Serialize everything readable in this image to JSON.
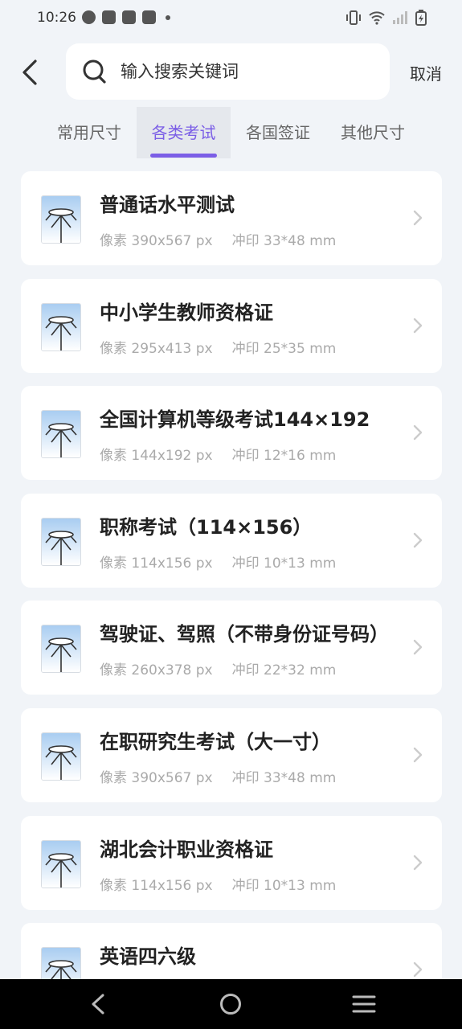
{
  "status_bar": {
    "time": "10:26"
  },
  "search": {
    "placeholder": "输入搜索关键词",
    "cancel_label": "取消"
  },
  "tabs": [
    {
      "label": "常用尺寸",
      "active": false
    },
    {
      "label": "各类考试",
      "active": true
    },
    {
      "label": "各国签证",
      "active": false
    },
    {
      "label": "其他尺寸",
      "active": false
    }
  ],
  "items": [
    {
      "title": "普通话水平测试",
      "pixels": "像素 390x567 px",
      "print": "冲印 33*48 mm"
    },
    {
      "title": "中小学生教师资格证",
      "pixels": "像素 295x413 px",
      "print": "冲印 25*35 mm"
    },
    {
      "title": "全国计算机等级考试144×192",
      "pixels": "像素 144x192 px",
      "print": "冲印 12*16 mm"
    },
    {
      "title": "职称考试（114×156）",
      "pixels": "像素 114x156 px",
      "print": "冲印 10*13 mm"
    },
    {
      "title": "驾驶证、驾照（不带身份证号码）",
      "pixels": "像素 260x378 px",
      "print": "冲印 22*32 mm"
    },
    {
      "title": "在职研究生考试（大一寸）",
      "pixels": "像素 390x567 px",
      "print": "冲印 33*48 mm"
    },
    {
      "title": "湖北会计职业资格证",
      "pixels": "像素 114x156 px",
      "print": "冲印 10*13 mm"
    },
    {
      "title": "英语四六级",
      "pixels": "",
      "print": ""
    }
  ],
  "colors": {
    "accent": "#7b5ee6",
    "background": "#f1f4f8",
    "card": "#ffffff",
    "meta_text": "#aaaaaa"
  }
}
